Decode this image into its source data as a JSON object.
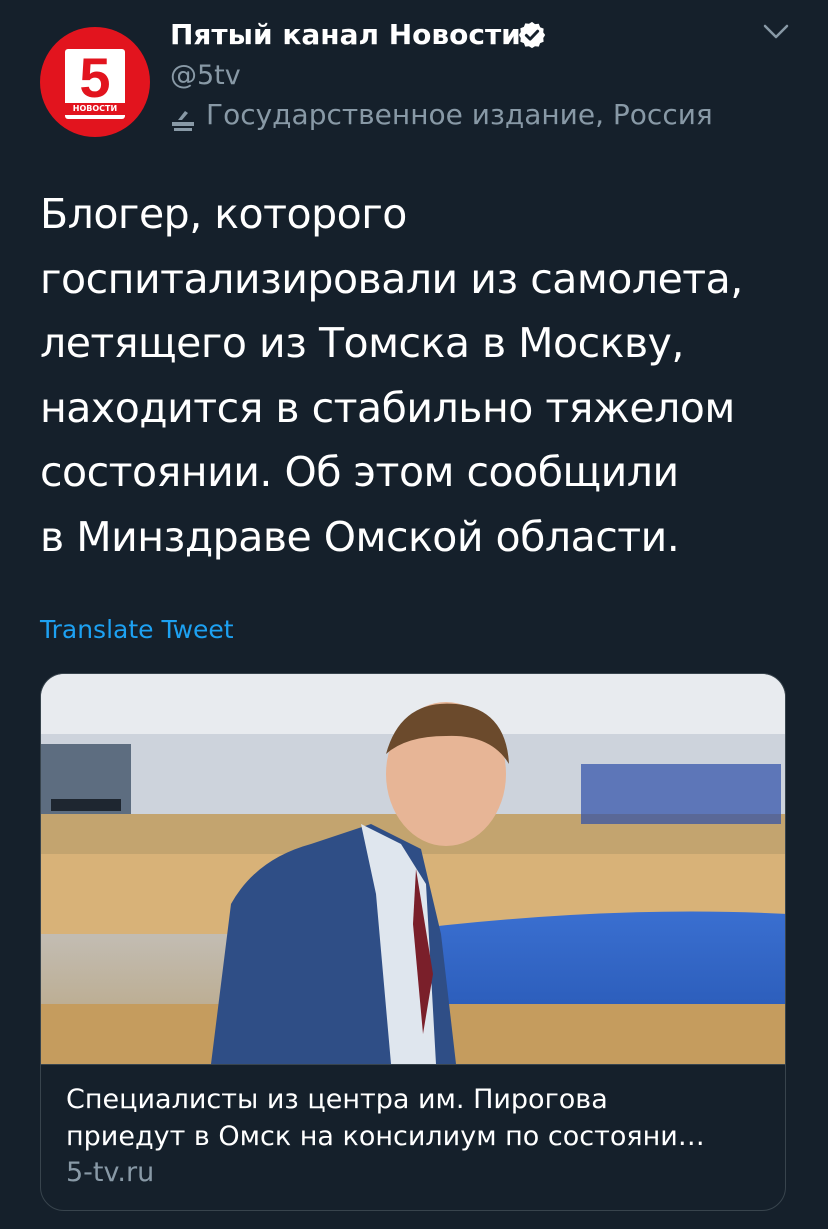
{
  "account": {
    "name": "Пятый канал Новости",
    "handle": "@5tv",
    "label": "Государственное издание, Россия",
    "avatar_number": "5",
    "avatar_caption": "НОВОСТИ",
    "verified_icon": "verified-badge-icon",
    "label_icon": "ballot-box-icon",
    "menu_icon": "chevron-down-icon"
  },
  "tweet": {
    "lines": [
      "Блогер, которого",
      "госпитализировали из самолета,",
      "летящего из Томска в Москву,",
      "находится в стабильно тяжелом",
      "состоянии. Об этом сообщили",
      "в Минздраве Омской области."
    ],
    "translate_label": "Translate Tweet"
  },
  "card": {
    "title_lines": [
      "Специалисты из центра им. Пирогова",
      "приедут в Омск на консилиум по состояни…"
    ],
    "domain": "5-tv.ru"
  },
  "colors": {
    "background": "#15202b",
    "text_primary": "#ffffff",
    "text_secondary": "#8899a6",
    "link": "#1da1f2",
    "border": "#38444d",
    "brand_red": "#e2141e"
  }
}
